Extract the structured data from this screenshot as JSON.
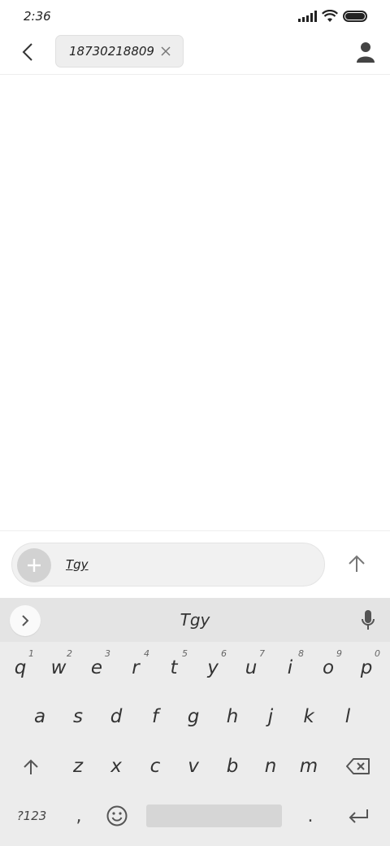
{
  "status_bar": {
    "time": "2:36",
    "icons": [
      "signal-icon",
      "wifi-icon",
      "battery-icon"
    ]
  },
  "header": {
    "back_icon": "chevron-left-icon",
    "recipient": "18730218809",
    "remove_icon": "close-icon",
    "contact_icon": "person-icon"
  },
  "compose": {
    "attach_icon": "plus-icon",
    "text": "Tgy",
    "send_icon": "arrow-up-icon"
  },
  "keyboard": {
    "suggestion": "Tgy",
    "expand_icon": "chevron-right-icon",
    "mic_icon": "microphone-icon",
    "row1": [
      {
        "key": "q",
        "hint": "1"
      },
      {
        "key": "w",
        "hint": "2"
      },
      {
        "key": "e",
        "hint": "3"
      },
      {
        "key": "r",
        "hint": "4"
      },
      {
        "key": "t",
        "hint": "5"
      },
      {
        "key": "y",
        "hint": "6"
      },
      {
        "key": "u",
        "hint": "7"
      },
      {
        "key": "i",
        "hint": "8"
      },
      {
        "key": "o",
        "hint": "9"
      },
      {
        "key": "p",
        "hint": "0"
      }
    ],
    "row2": [
      "a",
      "s",
      "d",
      "f",
      "g",
      "h",
      "j",
      "k",
      "l"
    ],
    "row3": [
      "z",
      "x",
      "c",
      "v",
      "b",
      "n",
      "m"
    ],
    "symbols_label": "?123",
    "comma": ",",
    "period": ".",
    "shift_icon": "shift-arrow-icon",
    "backspace_icon": "backspace-icon",
    "emoji_icon": "smiley-icon",
    "enter_icon": "enter-icon"
  },
  "colors": {
    "background": "#ffffff",
    "keyboard_bg": "#ececec",
    "suggest_bar_bg": "#e4e4e4",
    "text": "#222222",
    "chip_bg": "#eeeeee"
  }
}
